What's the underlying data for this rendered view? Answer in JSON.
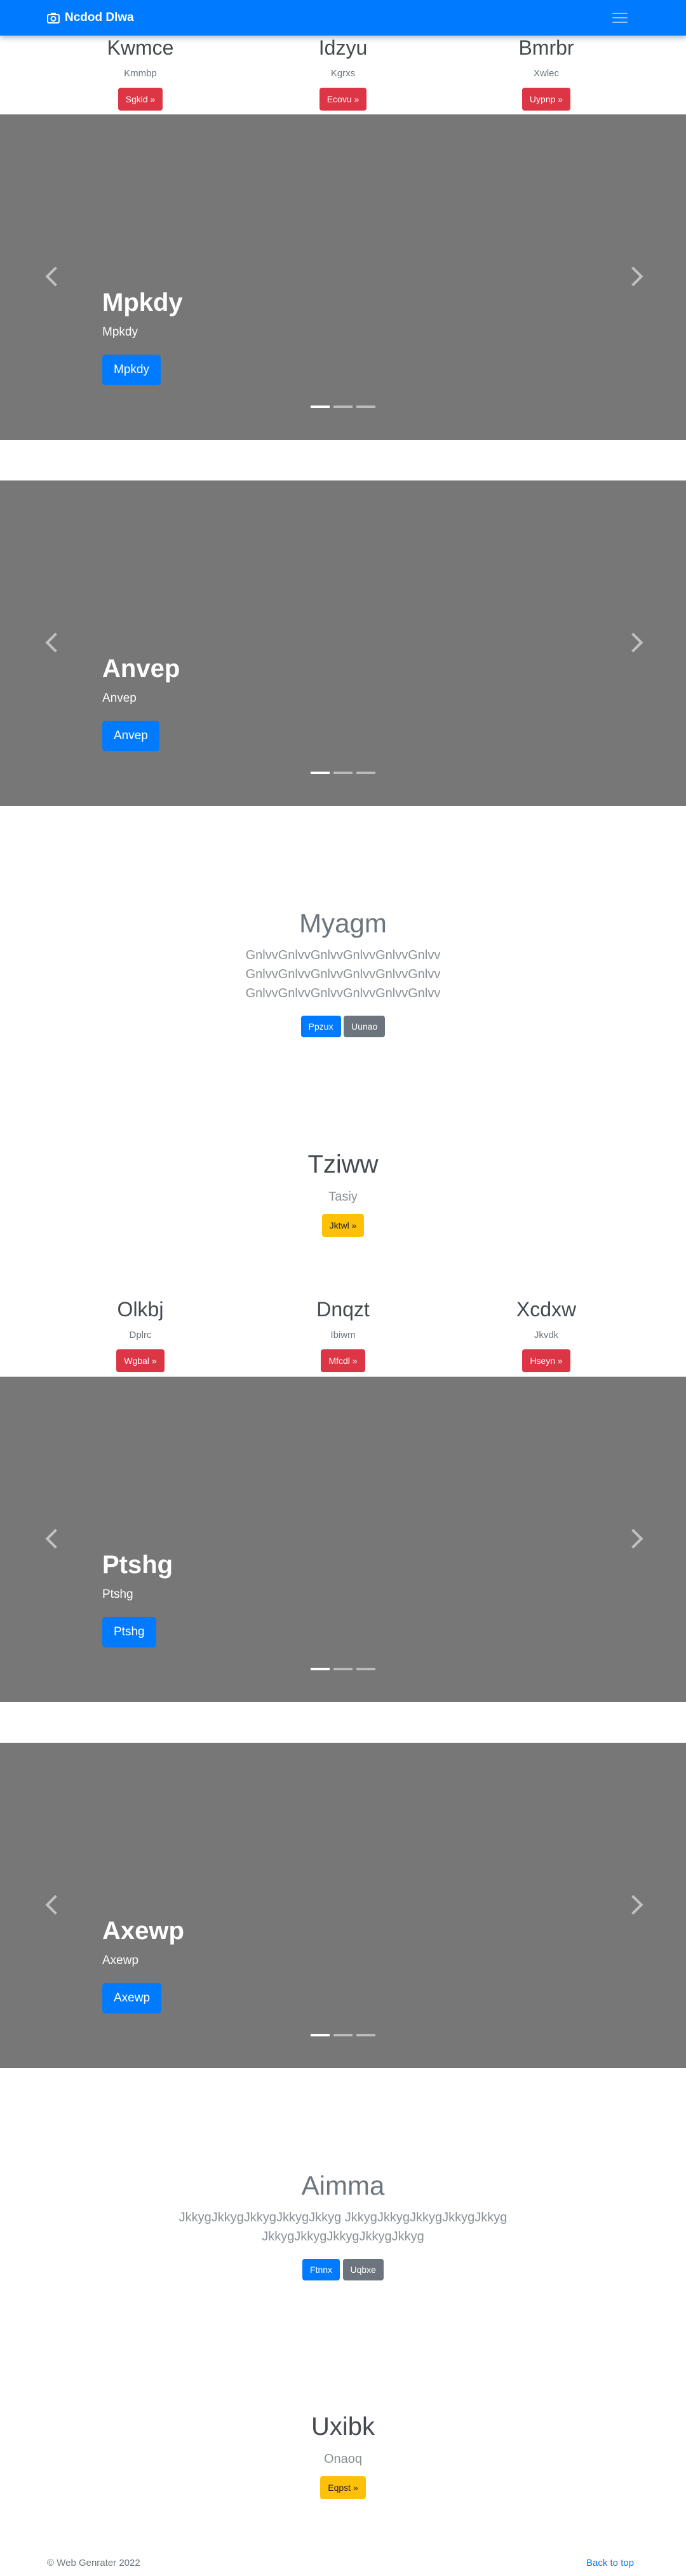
{
  "navbar": {
    "brand": "Ncdod Dlwa",
    "brand_icon": "camera-icon",
    "toggler_icon": "hamburger-menu-icon"
  },
  "features1": [
    {
      "title": "Kwmce",
      "text": "Kmmbp",
      "button": "Sgkid »"
    },
    {
      "title": "Idzyu",
      "text": "Kgrxs",
      "button": "Ecovu »"
    },
    {
      "title": "Bmrbr",
      "text": "Xwlec",
      "button": "Uypnp »"
    }
  ],
  "carousel1": {
    "heading": "Mpkdy",
    "subtitle": "Mpkdy",
    "button": "Mpkdy",
    "active_slide": 1,
    "slides": 3
  },
  "carousel2": {
    "heading": "Anvep",
    "subtitle": "Anvep",
    "button": "Anvep",
    "active_slide": 1,
    "slides": 3
  },
  "jumbo1": {
    "heading": "Myagm",
    "lead": "GnlvvGnlvvGnlvvGnlvvGnlvvGnlvv GnlvvGnlvvGnlvvGnlvvGnlvvGnlvv GnlvvGnlvvGnlvvGnlvvGnlvvGnlvv",
    "primary": "Ppzux",
    "secondary": "Uunao"
  },
  "cta1": {
    "heading": "Tziww",
    "text": "Tasiy",
    "button": "Jktwl »"
  },
  "features2": [
    {
      "title": "Olkbj",
      "text": "Dplrc",
      "button": "Wgbal »"
    },
    {
      "title": "Dnqzt",
      "text": "Ibiwm",
      "button": "Mfcdl »"
    },
    {
      "title": "Xcdxw",
      "text": "Jkvdk",
      "button": "Hseyn »"
    }
  ],
  "carousel3": {
    "heading": "Ptshg",
    "subtitle": "Ptshg",
    "button": "Ptshg",
    "active_slide": 1,
    "slides": 3
  },
  "carousel4": {
    "heading": "Axewp",
    "subtitle": "Axewp",
    "button": "Axewp",
    "active_slide": 1,
    "slides": 3
  },
  "jumbo2": {
    "heading": "Aimma",
    "lead": "JkkygJkkygJkkygJkkygJkkyg JkkygJkkygJkkygJkkygJkkyg JkkygJkkygJkkygJkkygJkkyg",
    "primary": "Ftnnx",
    "secondary": "Uqbxe"
  },
  "cta2": {
    "heading": "Uxibk",
    "text": "Onaoq",
    "button": "Eqpst »"
  },
  "footer": {
    "copyright": "© Web Genrater 2022",
    "back_to_top": "Back to top"
  },
  "colors": {
    "primary": "#007bff",
    "danger": "#dc3545",
    "secondary": "#6c757d",
    "warning": "#ffc107",
    "carousel_bg": "#777777"
  }
}
